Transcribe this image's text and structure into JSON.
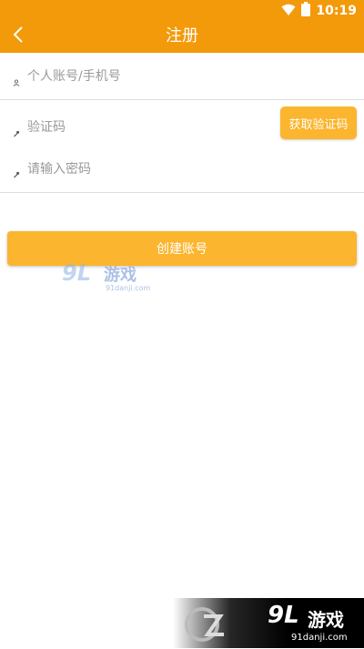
{
  "status_bar": {
    "time": "10:19",
    "icons": [
      "wifi-icon",
      "battery-icon"
    ]
  },
  "app_bar": {
    "title": "注册",
    "back_icon": "chevron-left-icon"
  },
  "form": {
    "account_placeholder": "个人账号/手机号",
    "code_placeholder": "验证码",
    "code_button": "获取验证码",
    "password_placeholder": "请输入密码",
    "submit_button": "创建账号"
  },
  "watermark": {
    "brand_num": "9L",
    "brand_cn": "游戏",
    "domain": "91danji.com"
  },
  "colors": {
    "accent": "#f39a0a",
    "button": "#fbb52e"
  }
}
